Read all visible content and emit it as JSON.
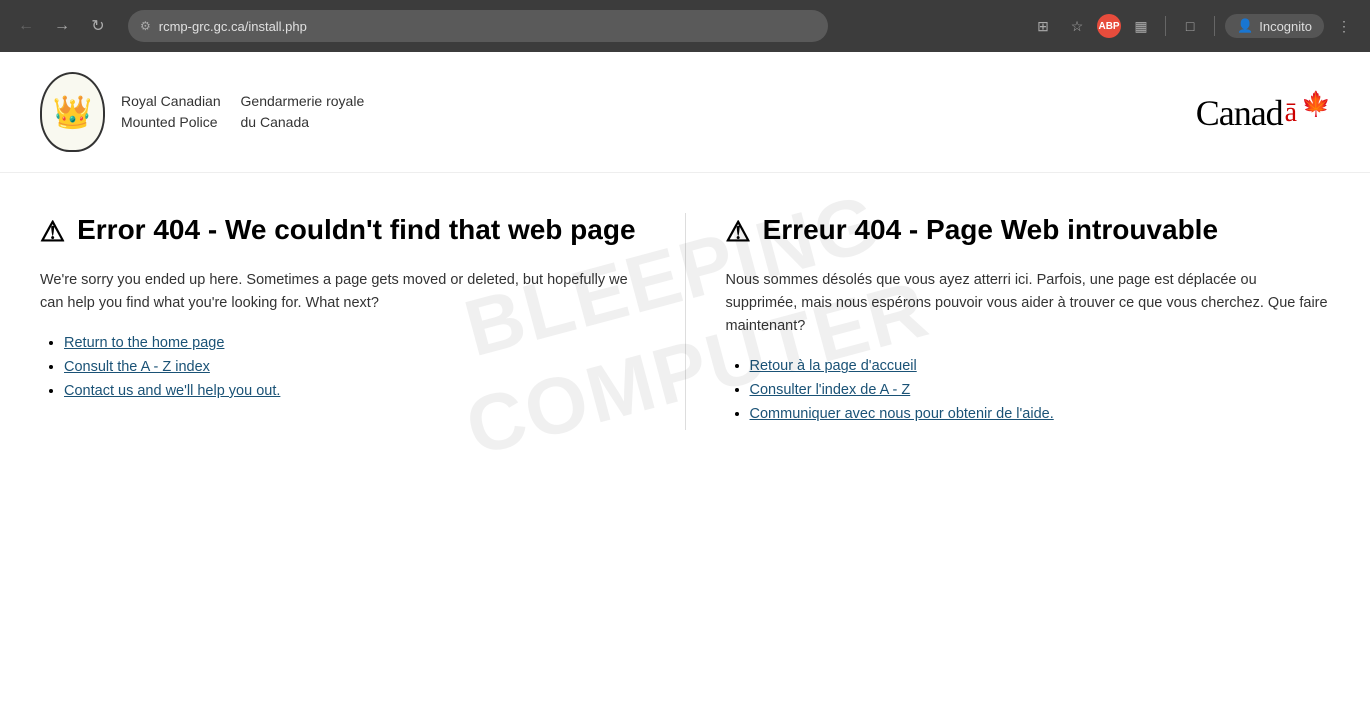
{
  "browser": {
    "url": "rcmp-grc.gc.ca/install.php",
    "incognito_label": "Incognito",
    "abp_label": "ABP"
  },
  "header": {
    "org_name_en": "Royal Canadian\nMounted Police",
    "org_name_fr": "Gendarmerie royale\ndu Canada",
    "canada_wordmark": "Canad",
    "canada_flag": "🍁"
  },
  "english": {
    "heading": "Error 404 - We couldn't find that web page",
    "warning_icon": "⚠",
    "description": "We're sorry you ended up here. Sometimes a page gets moved or deleted, but hopefully we can help you find what you're looking for. What next?",
    "links": [
      {
        "text": "Return to the home page",
        "href": "#"
      },
      {
        "text": "Consult the A - Z index",
        "href": "#"
      },
      {
        "text": "Contact us and we'll help you out.",
        "href": "#"
      }
    ]
  },
  "french": {
    "heading": "Erreur 404 - Page Web introuvable",
    "warning_icon": "⚠",
    "description": "Nous sommes désolés que vous ayez atterri ici. Parfois, une page est déplacée ou supprimée, mais nous espérons pouvoir vous aider à trouver ce que vous cherchez. Que faire maintenant?",
    "links": [
      {
        "text": "Retour à la page d'accueil",
        "href": "#"
      },
      {
        "text": "Consulter l'index de A - Z",
        "href": "#"
      },
      {
        "text": "Communiquer avec nous pour obtenir de l'aide.",
        "href": "#"
      }
    ]
  },
  "watermark": {
    "line1": "BLEEPING",
    "line2": "COMPUTER"
  }
}
